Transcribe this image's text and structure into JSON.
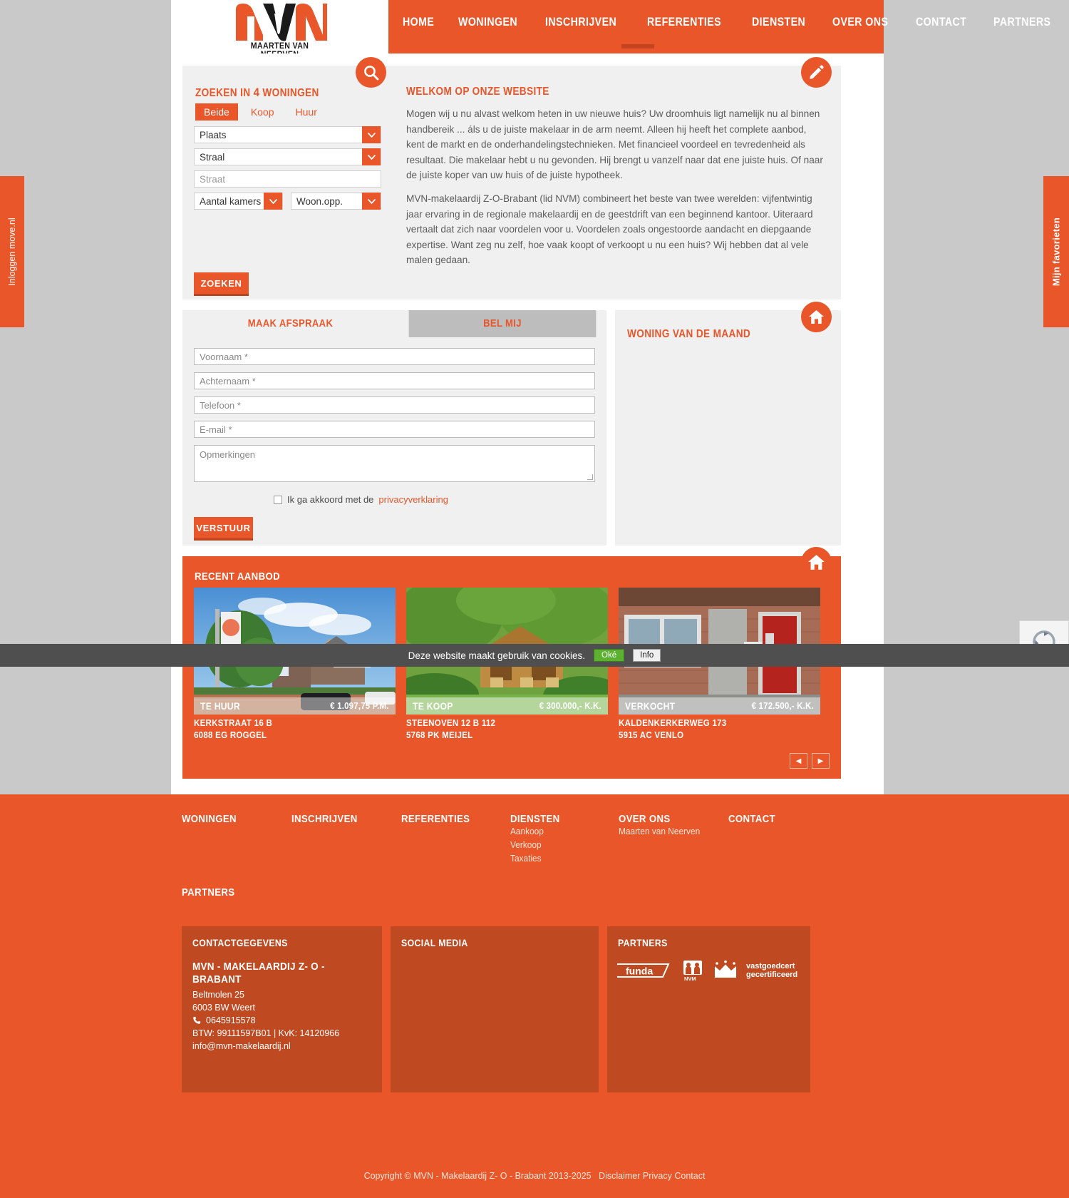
{
  "brand": {
    "logo_text": "MAARTEN VAN NEERVEN",
    "accent": "#e8562a",
    "accent_dark": "#bf4a22"
  },
  "nav": {
    "items": [
      {
        "label": "HOME",
        "name": "nav-home"
      },
      {
        "label": "WONINGEN",
        "name": "nav-woningen"
      },
      {
        "label": "INSCHRIJVEN",
        "name": "nav-inschrijven"
      },
      {
        "label": "REFERENTIES",
        "name": "nav-referenties"
      },
      {
        "label": "DIENSTEN",
        "name": "nav-diensten"
      },
      {
        "label": "OVER ONS",
        "name": "nav-over-ons"
      },
      {
        "label": "CONTACT",
        "name": "nav-contact"
      },
      {
        "label": "PARTNERS",
        "name": "nav-partners"
      }
    ]
  },
  "side_tabs": {
    "left": "Inloggen move.nl",
    "right": "Mijn favorieten"
  },
  "search": {
    "title_pre": "ZOEKEN IN ",
    "count": "4",
    "title_post": " WONINGEN",
    "tabs": [
      {
        "label": "Beide",
        "active": true
      },
      {
        "label": "Koop",
        "active": false
      },
      {
        "label": "Huur",
        "active": false
      }
    ],
    "fields": {
      "plaats": "Plaats",
      "straal": "Straal",
      "straat_placeholder": "Straat",
      "kamers": "Aantal kamers",
      "oppervlakte": "Woon.opp."
    },
    "submit_label": "ZOEKEN"
  },
  "welcome": {
    "title": "WELKOM OP ONZE WEBSITE",
    "paragraph1": "Mogen wij u nu alvast welkom heten in uw nieuwe huis? Uw droomhuis ligt namelijk nu al binnen handbereik ... áls u de juiste makelaar in de arm neemt. Alleen hij heeft het complete aanbod, kent de markt en de onderhandelingstechnieken. Met financieel voordeel en tevredenheid als resultaat. Die makelaar hebt u nu gevonden. Hij brengt u vanzelf naar dat ene juiste huis. Of naar de juiste koper van uw huis of de juiste hypotheek.",
    "paragraph2": "MVN-makelaardij Z-O-Brabant (lid NVM) combineert het beste van twee werelden: vijfentwintig jaar ervaring in de regionale makelaardij en de geestdrift van een beginnend kantoor. Uiteraard vertaalt dat zich naar voordelen voor u. Voordelen zoals ongestoorde aandacht en diepgaande expertise. Want zeg nu zelf, hoe vaak koopt of verkoopt u nu een huis? Wij hebben dat al vele malen gedaan."
  },
  "contact_form": {
    "tabs": [
      {
        "label": "MAAK AFSPRAAK",
        "active": true
      },
      {
        "label": "BEL MIJ",
        "active": false
      }
    ],
    "fields": {
      "voornaam": "Voornaam *",
      "achternaam": "Achternaam *",
      "telefoon": "Telefoon *",
      "email": "E-mail *",
      "opmerkingen": "Opmerkingen"
    },
    "agree_text": "Ik ga akkoord met de",
    "agree_link": "privacyverklaring",
    "submit_label": "VERSTUUR"
  },
  "woning_maand": {
    "title": "WONING VAN DE MAAND"
  },
  "recent": {
    "title": "RECENT AANBOD",
    "items": [
      {
        "status": "TE HUUR",
        "price": "€ 1.097,75 P.M.",
        "address": "KERKSTRAAT 16 B",
        "city": "6088 EG ROGGEL",
        "photo": "house-terraced-blue-sky"
      },
      {
        "status": "TE KOOP",
        "price": "€ 300.000,- K.K.",
        "address": "STEENOVEN 12 B 112",
        "city": "5768 PK MEIJEL",
        "photo": "wooden-chalet-in-trees"
      },
      {
        "status": "VERKOCHT",
        "price": "€ 172.500,- K.K.",
        "address": "KALDENKERKERWEG 173",
        "city": "5915 AC VENLO",
        "photo": "brick-house-red-door"
      }
    ],
    "prev_label": "◀",
    "next_label": "▶"
  },
  "footer": {
    "columns": [
      {
        "title": "WONINGEN",
        "links": []
      },
      {
        "title": "INSCHRIJVEN",
        "links": []
      },
      {
        "title": "REFERENTIES",
        "links": []
      },
      {
        "title": "DIENSTEN",
        "links": [
          "Aankoop",
          "Verkoop",
          "Taxaties"
        ]
      },
      {
        "title": "OVER ONS",
        "links": [
          "Maarten van Neerven"
        ]
      },
      {
        "title": "CONTACT",
        "links": []
      }
    ],
    "partners_heading": "PARTNERS",
    "boxes": {
      "contact": {
        "title": "CONTACTGEGEVENS",
        "company": "MVN - MAKELAARDIJ Z- O - BRABANT",
        "street": "Beltmolen 25",
        "city": "6003 BW Weert",
        "phone": "0645915578",
        "registration": "BTW: 99111597B01 | KvK: 14120966",
        "email": "info@mvn-makelaardij.nl"
      },
      "social": {
        "title": "SOCIAL MEDIA"
      },
      "partners": {
        "title": "PARTNERS",
        "logos": [
          "funda",
          "NVM",
          "vastgoedcert gecertificeerd"
        ]
      }
    },
    "copyright": "Copyright © MVN - Makelaardij Z- O - Brabant 2013-2025",
    "copy_links": [
      "Disclaimer",
      "Privacy",
      "Contact"
    ]
  },
  "cookie_bar": {
    "text": "Deze website maakt gebruik van cookies.",
    "ok_label": "Oké",
    "info_label": "Info"
  }
}
